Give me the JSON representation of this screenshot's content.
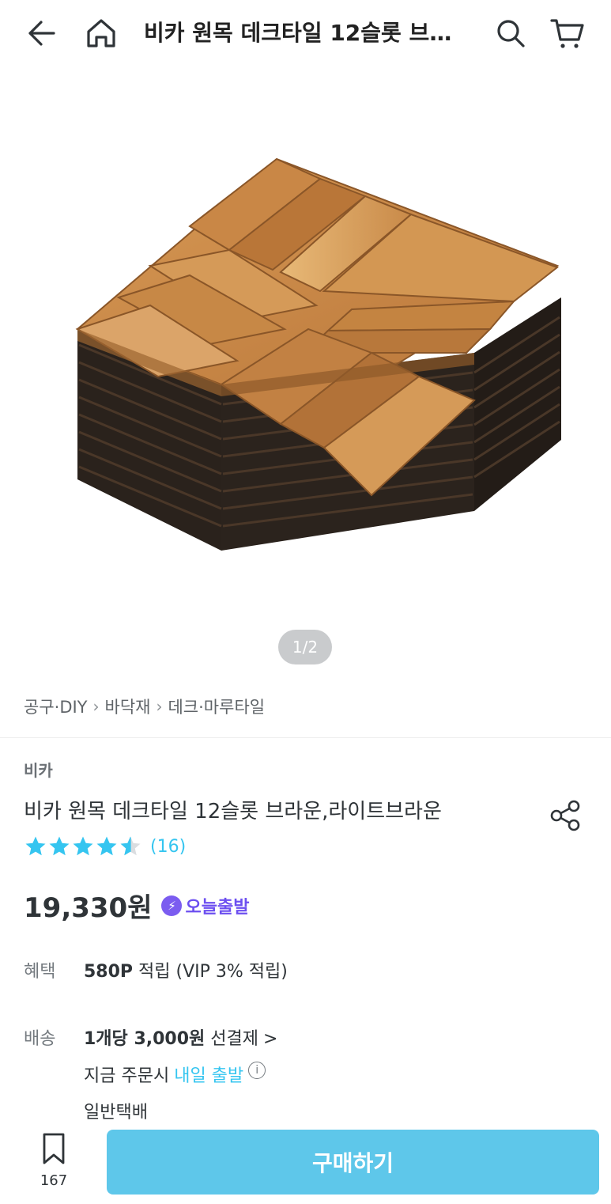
{
  "header": {
    "title": "비카 원목 데크타일 12슬롯 브라운,라이트브라운",
    "back_icon": "arrow-left-icon",
    "home_icon": "home-icon",
    "search_icon": "search-icon",
    "cart_icon": "cart-icon"
  },
  "gallery": {
    "image_alt": "acacia wood deck tiles stack",
    "pager": "1/2"
  },
  "breadcrumb": {
    "items": [
      "공구·DIY",
      "바닥재",
      "데크·마루타일"
    ]
  },
  "product": {
    "brand": "비카",
    "name": "비카 원목 데크타일 12슬롯 브라운,라이트브라운",
    "rating": 4.5,
    "review_count": "(16)",
    "price": "19,330원",
    "badge": "오늘출발"
  },
  "benefit": {
    "label": "혜택",
    "points": "580P",
    "text": " 적립 (VIP 3% 적립)"
  },
  "delivery": {
    "label": "배송",
    "fee": "1개당 3,000원",
    "fee_suffix": " 선결제",
    "chevron": ">",
    "order_now": "지금 주문시 ",
    "tomorrow": "내일 출발",
    "method": "일반택배"
  },
  "bottom": {
    "bookmark_count": "167",
    "buy_label": "구매하기"
  },
  "colors": {
    "accent": "#35c5f0",
    "buy_button": "#5ec7ea",
    "badge": "#6c4ff0",
    "text": "#2f3438"
  }
}
